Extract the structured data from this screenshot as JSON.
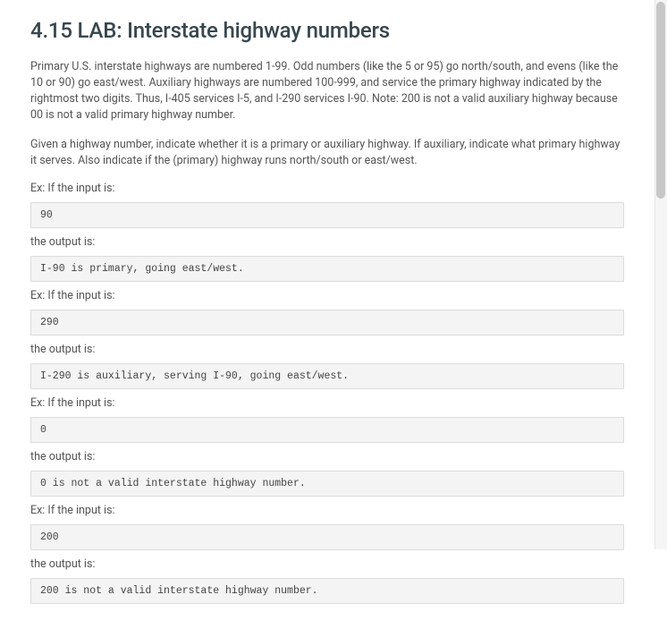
{
  "title": "4.15 LAB: Interstate highway numbers",
  "paragraphs": {
    "p1": "Primary U.S. interstate highways are numbered 1-99. Odd numbers (like the 5 or 95) go north/south, and evens (like the 10 or 90) go east/west. Auxiliary highways are numbered 100-999, and service the primary highway indicated by the rightmost two digits. Thus, I-405 services I-5, and I-290 services I-90. Note: 200 is not a valid auxiliary highway because 00 is not a valid primary highway number.",
    "p2": "Given a highway number, indicate whether it is a primary or auxiliary highway. If auxiliary, indicate what primary highway it serves. Also indicate if the (primary) highway runs north/south or east/west."
  },
  "labels": {
    "ex_input": "Ex: If the input is:",
    "output_is": "the output is:"
  },
  "examples": {
    "ex1": {
      "input": "90",
      "output": "I-90 is primary, going east/west."
    },
    "ex2": {
      "input": "290",
      "output": "I-290 is auxiliary, serving I-90, going east/west."
    },
    "ex3": {
      "input": "0",
      "output": "0 is not a valid interstate highway number."
    },
    "ex4": {
      "input": "200",
      "output": "200 is not a valid interstate highway number."
    }
  }
}
